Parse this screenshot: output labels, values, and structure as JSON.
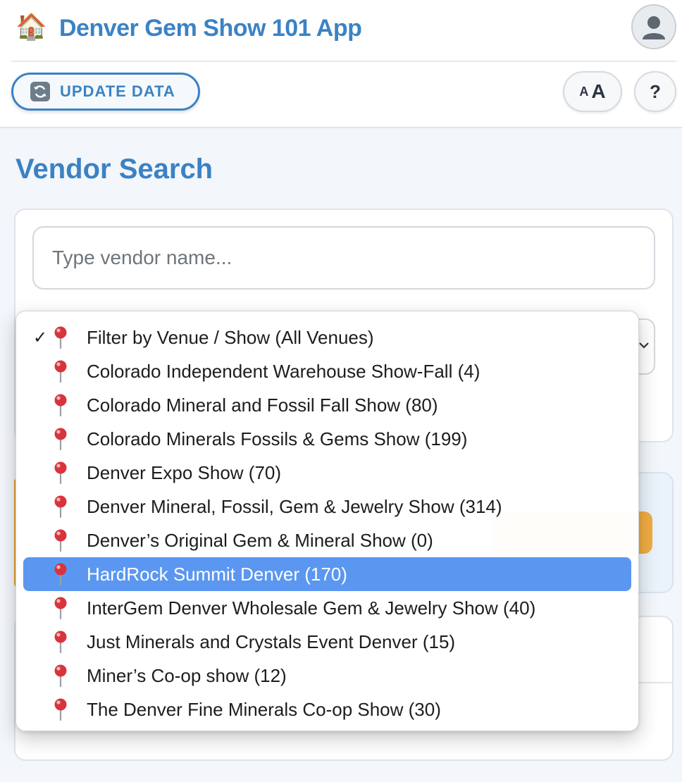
{
  "app": {
    "icon": "house-icon",
    "title": "Denver Gem Show 101 App"
  },
  "toolbar": {
    "update_label": "UPDATE DATA",
    "update_icon": "refresh-icon",
    "font_small": "A",
    "font_large": "A",
    "help_label": "?"
  },
  "main": {
    "section_title": "Vendor Search",
    "search": {
      "placeholder": "Type vendor name..."
    }
  },
  "venue_dropdown": {
    "checked_index": 0,
    "highlighted_index": 7,
    "options": [
      "Filter by Venue / Show (All Venues)",
      "Colorado Independent Warehouse Show-Fall (4)",
      "Colorado Mineral and Fossil Fall Show (80)",
      "Colorado Minerals Fossils & Gems Show (199)",
      "Denver Expo Show (70)",
      "Denver Mineral, Fossil, Gem & Jewelry Show (314)",
      "Denver’s Original Gem & Mineral Show (0)",
      "HardRock Summit Denver (170)",
      "InterGem Denver Wholesale Gem & Jewelry Show (40)",
      "Just Minerals and Crystals Event Denver (15)",
      "Miner’s Co-op show (12)",
      "The Denver Fine Minerals Co-op Show (30)"
    ],
    "check_glyph": "✓",
    "option_icon": "pushpin-icon"
  },
  "colors": {
    "brand": "#3b82c4",
    "highlight": "#5b97f0",
    "accent": "#f0ac44",
    "pin": "#d9343b"
  }
}
